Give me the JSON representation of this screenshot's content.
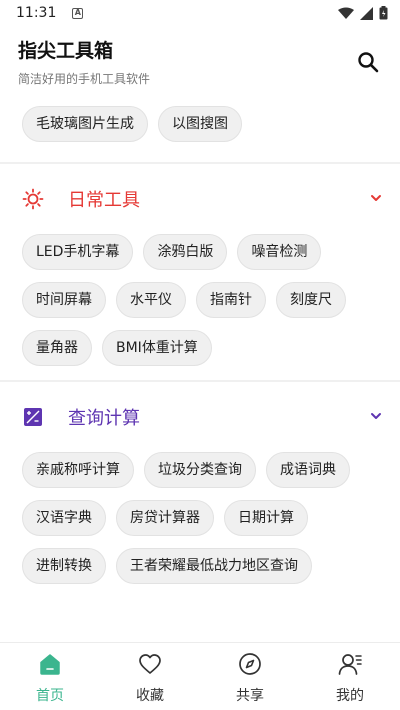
{
  "status": {
    "time": "11:31",
    "notif_glyph": "A"
  },
  "header": {
    "title": "指尖工具箱",
    "subtitle": "简洁好用的手机工具软件"
  },
  "top_chips": [
    "毛玻璃图片生成",
    "以图搜图"
  ],
  "sections": [
    {
      "title": "日常工具",
      "color": "#e53935",
      "icon": "sun-icon",
      "chips": [
        "LED手机字幕",
        "涂鸦白版",
        "噪音检测",
        "时间屏幕",
        "水平仪",
        "指南针",
        "刻度尺",
        "量角器",
        "BMI体重计算"
      ]
    },
    {
      "title": "查询计算",
      "color": "#5e35b1",
      "icon": "calculator-icon",
      "chips": [
        "亲戚称呼计算",
        "垃圾分类查询",
        "成语词典",
        "汉语字典",
        "房贷计算器",
        "日期计算",
        "进制转换",
        "王者荣耀最低战力地区查询"
      ]
    }
  ],
  "nav": [
    {
      "label": "首页",
      "icon": "home-icon",
      "active": true
    },
    {
      "label": "收藏",
      "icon": "heart-icon",
      "active": false
    },
    {
      "label": "共享",
      "icon": "compass-icon",
      "active": false
    },
    {
      "label": "我的",
      "icon": "profile-icon",
      "active": false
    }
  ],
  "colors": {
    "accent": "#3bb58e",
    "daily": "#e53935",
    "query": "#5e35b1"
  }
}
